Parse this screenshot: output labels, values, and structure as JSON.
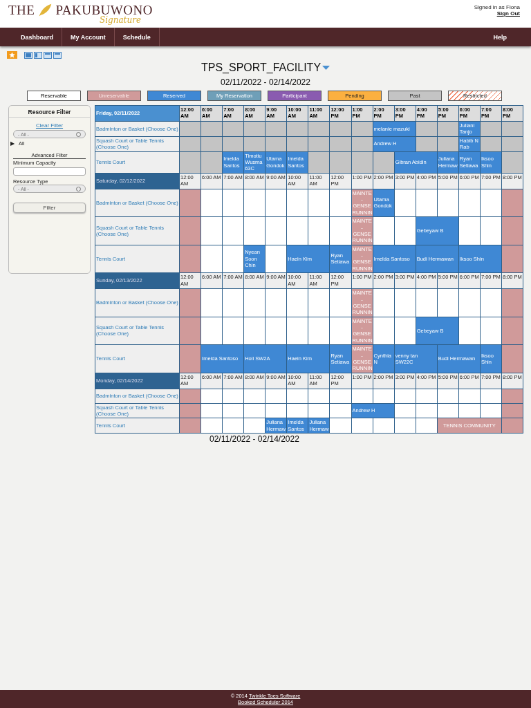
{
  "brand": {
    "name_first": "THE",
    "name_second": "PAKUBUWONO",
    "tagline": "Signature"
  },
  "user": {
    "signed_in": "Signed in as Fiona",
    "sign_out": "Sign Out"
  },
  "nav": [
    {
      "label": "Dashboard"
    },
    {
      "label": "My Account"
    },
    {
      "label": "Schedule"
    }
  ],
  "nav_right": {
    "label": "Help"
  },
  "schedule": {
    "title": "TPS_SPORT_FACILITY",
    "date_range": "02/11/2022 - 02/14/2022",
    "date_range_bottom": "02/11/2022 - 02/14/2022"
  },
  "legend": [
    {
      "label": "Reservable",
      "kind": "reservable"
    },
    {
      "label": "Unreservable",
      "kind": "unreservable"
    },
    {
      "label": "Reserved",
      "kind": "reserved"
    },
    {
      "label": "My Reservation",
      "kind": "mine"
    },
    {
      "label": "Participant",
      "kind": "participant"
    },
    {
      "label": "Pending",
      "kind": "pending"
    },
    {
      "label": "Past",
      "kind": "past"
    },
    {
      "label": "Restricted",
      "kind": "restricted"
    }
  ],
  "filter": {
    "title": "Resource Filter",
    "clear": "Clear Filter",
    "select_value": "- All -",
    "tree_toggle": "▶",
    "tree_item": "All",
    "advanced": "Advanced Filter",
    "capacity_label": "Minimum Capacity",
    "type_label": "Resource Type",
    "type_value": "- All -",
    "button": "Filter"
  },
  "days": [
    {
      "date": "Friday, 02/11/2022",
      "highlighted": true,
      "slots": [
        "12:00 AM",
        "6:00 AM",
        "7:00 AM",
        "8:00 AM",
        "9:00 AM",
        "10:00 AM",
        "11:00 AM",
        "12:00 PM",
        "1:00 PM",
        "2:00 PM",
        "3:00 PM",
        "4:00 PM",
        "5:00 PM",
        "6:00 PM",
        "7:00 PM",
        "8:00 PM"
      ],
      "rows": [
        {
          "resource": "Badminton or Basket (Choose One)",
          "cells": [
            {
              "kind": "past"
            },
            {
              "kind": "past"
            },
            {
              "kind": "past"
            },
            {
              "kind": "past"
            },
            {
              "kind": "past"
            },
            {
              "kind": "past"
            },
            {
              "kind": "past"
            },
            {
              "kind": "past"
            },
            {
              "kind": "past"
            },
            {
              "kind": "reserved",
              "text": "melanie mazuki"
            },
            {
              "kind": "continued"
            },
            {
              "kind": "past"
            },
            {
              "kind": "past"
            },
            {
              "kind": "reserved",
              "text": "Juliani Tanjo"
            },
            {
              "kind": "past"
            },
            {
              "kind": "past"
            }
          ]
        },
        {
          "resource": "Squash Court or Table Tennis (Choose One)",
          "cells": [
            {
              "kind": "past"
            },
            {
              "kind": "past"
            },
            {
              "kind": "past"
            },
            {
              "kind": "past"
            },
            {
              "kind": "past"
            },
            {
              "kind": "past"
            },
            {
              "kind": "past"
            },
            {
              "kind": "past"
            },
            {
              "kind": "past"
            },
            {
              "kind": "reserved",
              "text": "Andrew H"
            },
            {
              "kind": "continued"
            },
            {
              "kind": "past"
            },
            {
              "kind": "past"
            },
            {
              "kind": "reserved",
              "text": "Habib N Rab"
            },
            {
              "kind": "past"
            },
            {
              "kind": "past"
            }
          ]
        },
        {
          "resource": "Tennis Court",
          "cells": [
            {
              "kind": "past"
            },
            {
              "kind": "past"
            },
            {
              "kind": "reserved",
              "text": "Imelda Santos"
            },
            {
              "kind": "reserved",
              "text": "Timotiu Wusma 63C"
            },
            {
              "kind": "reserved",
              "text": "Utama Gondok"
            },
            {
              "kind": "reserved",
              "text": "Imelda Santos"
            },
            {
              "kind": "past"
            },
            {
              "kind": "past"
            },
            {
              "kind": "past"
            },
            {
              "kind": "past"
            },
            {
              "kind": "reserved",
              "text": "Gibran Abidin"
            },
            {
              "kind": "continued"
            },
            {
              "kind": "reserved",
              "text": "Juliana Hermaw"
            },
            {
              "kind": "reserved",
              "text": "Ryan Setiawa"
            },
            {
              "kind": "reserved",
              "text": "Iksoo Shin"
            },
            {
              "kind": "past"
            }
          ]
        }
      ]
    },
    {
      "date": "Saturday, 02/12/2022",
      "highlighted": false,
      "slots": [
        "12:00 AM",
        "6:00 AM",
        "7:00 AM",
        "8:00 AM",
        "9:00 AM",
        "10:00 AM",
        "11:00 AM",
        "12:00 PM",
        "1:00 PM",
        "2:00 PM",
        "3:00 PM",
        "4:00 PM",
        "5:00 PM",
        "6:00 PM",
        "7:00 PM",
        "8:00 PM"
      ],
      "rows": [
        {
          "resource": "Badminton or Basket (Choose One)",
          "cells": [
            {
              "kind": "unreservable"
            },
            {
              "kind": "open"
            },
            {
              "kind": "open"
            },
            {
              "kind": "open"
            },
            {
              "kind": "open"
            },
            {
              "kind": "open"
            },
            {
              "kind": "open"
            },
            {
              "kind": "open"
            },
            {
              "kind": "unreservable",
              "text": "MAINTE - GENSE RUNNIN"
            },
            {
              "kind": "reserved",
              "text": "Utama Gondok"
            },
            {
              "kind": "open"
            },
            {
              "kind": "open"
            },
            {
              "kind": "open"
            },
            {
              "kind": "open"
            },
            {
              "kind": "open"
            },
            {
              "kind": "unreservable"
            }
          ]
        },
        {
          "resource": "Squash Court or Table Tennis (Choose One)",
          "cells": [
            {
              "kind": "unreservable"
            },
            {
              "kind": "open"
            },
            {
              "kind": "open"
            },
            {
              "kind": "open"
            },
            {
              "kind": "open"
            },
            {
              "kind": "open"
            },
            {
              "kind": "open"
            },
            {
              "kind": "open"
            },
            {
              "kind": "unreservable",
              "text": "MAINTE - GENSE RUNNIN"
            },
            {
              "kind": "open"
            },
            {
              "kind": "open"
            },
            {
              "kind": "reserved",
              "text": "Gebeyaw B"
            },
            {
              "kind": "continued"
            },
            {
              "kind": "open"
            },
            {
              "kind": "open"
            },
            {
              "kind": "unreservable"
            }
          ]
        },
        {
          "resource": "Tennis Court",
          "cells": [
            {
              "kind": "unreservable"
            },
            {
              "kind": "open"
            },
            {
              "kind": "open"
            },
            {
              "kind": "reserved",
              "text": "Nyean Soon Chin"
            },
            {
              "kind": "open"
            },
            {
              "kind": "reserved",
              "text": "Haein Kim"
            },
            {
              "kind": "continued"
            },
            {
              "kind": "reserved",
              "text": "Ryan Setiawa"
            },
            {
              "kind": "unreservable",
              "text": "MAINTE - GENSE RUNNIN"
            },
            {
              "kind": "reserved",
              "text": "Imelda Santoso"
            },
            {
              "kind": "continued"
            },
            {
              "kind": "reserved",
              "text": "Budi Hermawan"
            },
            {
              "kind": "continued"
            },
            {
              "kind": "reserved",
              "text": "Iksoo Shin"
            },
            {
              "kind": "continued"
            },
            {
              "kind": "unreservable"
            }
          ]
        }
      ]
    },
    {
      "date": "Sunday, 02/13/2022",
      "highlighted": false,
      "slots": [
        "12:00 AM",
        "6:00 AM",
        "7:00 AM",
        "8:00 AM",
        "9:00 AM",
        "10:00 AM",
        "11:00 AM",
        "12:00 PM",
        "1:00 PM",
        "2:00 PM",
        "3:00 PM",
        "4:00 PM",
        "5:00 PM",
        "6:00 PM",
        "7:00 PM",
        "8:00 PM"
      ],
      "rows": [
        {
          "resource": "Badminton or Basket (Choose One)",
          "cells": [
            {
              "kind": "unreservable"
            },
            {
              "kind": "open"
            },
            {
              "kind": "open"
            },
            {
              "kind": "open"
            },
            {
              "kind": "open"
            },
            {
              "kind": "open"
            },
            {
              "kind": "open"
            },
            {
              "kind": "open"
            },
            {
              "kind": "unreservable",
              "text": "MAINTE - GENSE RUNNIN"
            },
            {
              "kind": "open"
            },
            {
              "kind": "open"
            },
            {
              "kind": "open"
            },
            {
              "kind": "open"
            },
            {
              "kind": "open"
            },
            {
              "kind": "open"
            },
            {
              "kind": "unreservable"
            }
          ]
        },
        {
          "resource": "Squash Court or Table Tennis (Choose One)",
          "cells": [
            {
              "kind": "unreservable"
            },
            {
              "kind": "open"
            },
            {
              "kind": "open"
            },
            {
              "kind": "open"
            },
            {
              "kind": "open"
            },
            {
              "kind": "open"
            },
            {
              "kind": "open"
            },
            {
              "kind": "open"
            },
            {
              "kind": "unreservable",
              "text": "MAINTE - GENSE RUNNIN"
            },
            {
              "kind": "open"
            },
            {
              "kind": "open"
            },
            {
              "kind": "reserved",
              "text": "Gebeyaw B"
            },
            {
              "kind": "continued"
            },
            {
              "kind": "open"
            },
            {
              "kind": "open"
            },
            {
              "kind": "unreservable"
            }
          ]
        },
        {
          "resource": "Tennis Court",
          "cells": [
            {
              "kind": "unreservable"
            },
            {
              "kind": "reserved",
              "text": "Imelda Santoso"
            },
            {
              "kind": "continued"
            },
            {
              "kind": "reserved",
              "text": "Holi SW2A"
            },
            {
              "kind": "continued"
            },
            {
              "kind": "reserved",
              "text": "Haein Kim"
            },
            {
              "kind": "continued"
            },
            {
              "kind": "reserved",
              "text": "Ryan Setiawa"
            },
            {
              "kind": "unreservable",
              "text": "MAINTE - GENSE RUNNIN"
            },
            {
              "kind": "reserved",
              "text": "Cynthia N"
            },
            {
              "kind": "reserved",
              "text": "venny tan SW22C"
            },
            {
              "kind": "continued"
            },
            {
              "kind": "reserved",
              "text": "Budi Hermawan"
            },
            {
              "kind": "continued"
            },
            {
              "kind": "reserved",
              "text": "Iksoo Shin"
            },
            {
              "kind": "unreservable"
            }
          ]
        }
      ]
    },
    {
      "date": "Monday, 02/14/2022",
      "highlighted": false,
      "slots": [
        "12:00 AM",
        "6:00 AM",
        "7:00 AM",
        "8:00 AM",
        "9:00 AM",
        "10:00 AM",
        "11:00 AM",
        "12:00 PM",
        "1:00 PM",
        "2:00 PM",
        "3:00 PM",
        "4:00 PM",
        "5:00 PM",
        "6:00 PM",
        "7:00 PM",
        "8:00 PM"
      ],
      "rows": [
        {
          "resource": "Badminton or Basket (Choose One)",
          "cells": [
            {
              "kind": "unreservable"
            },
            {
              "kind": "open"
            },
            {
              "kind": "open"
            },
            {
              "kind": "open"
            },
            {
              "kind": "open"
            },
            {
              "kind": "open"
            },
            {
              "kind": "open"
            },
            {
              "kind": "open"
            },
            {
              "kind": "open"
            },
            {
              "kind": "open"
            },
            {
              "kind": "open"
            },
            {
              "kind": "open"
            },
            {
              "kind": "open"
            },
            {
              "kind": "open"
            },
            {
              "kind": "open"
            },
            {
              "kind": "unreservable"
            }
          ]
        },
        {
          "resource": "Squash Court or Table Tennis (Choose One)",
          "cells": [
            {
              "kind": "unreservable"
            },
            {
              "kind": "open"
            },
            {
              "kind": "open"
            },
            {
              "kind": "open"
            },
            {
              "kind": "open"
            },
            {
              "kind": "open"
            },
            {
              "kind": "open"
            },
            {
              "kind": "open"
            },
            {
              "kind": "reserved",
              "text": "Andrew H"
            },
            {
              "kind": "continued"
            },
            {
              "kind": "open"
            },
            {
              "kind": "open"
            },
            {
              "kind": "open"
            },
            {
              "kind": "open"
            },
            {
              "kind": "open"
            },
            {
              "kind": "unreservable"
            }
          ]
        },
        {
          "resource": "Tennis Court",
          "cells": [
            {
              "kind": "unreservable"
            },
            {
              "kind": "open"
            },
            {
              "kind": "open"
            },
            {
              "kind": "open"
            },
            {
              "kind": "reserved",
              "text": "Juliana Hermaw"
            },
            {
              "kind": "reserved",
              "text": "Imelda Santos"
            },
            {
              "kind": "reserved",
              "text": "Juliana Hermaw"
            },
            {
              "kind": "open"
            },
            {
              "kind": "open"
            },
            {
              "kind": "open"
            },
            {
              "kind": "open"
            },
            {
              "kind": "open"
            },
            {
              "kind": "unreservable",
              "text": "TENNIS COMMUNITY"
            },
            {
              "kind": "continued"
            },
            {
              "kind": "continued"
            },
            {
              "kind": "unreservable"
            }
          ]
        }
      ]
    }
  ],
  "footer": {
    "copyright": "© 2014",
    "company": "Twinkle Toes Software",
    "product": "Booked Scheduler 2014"
  }
}
